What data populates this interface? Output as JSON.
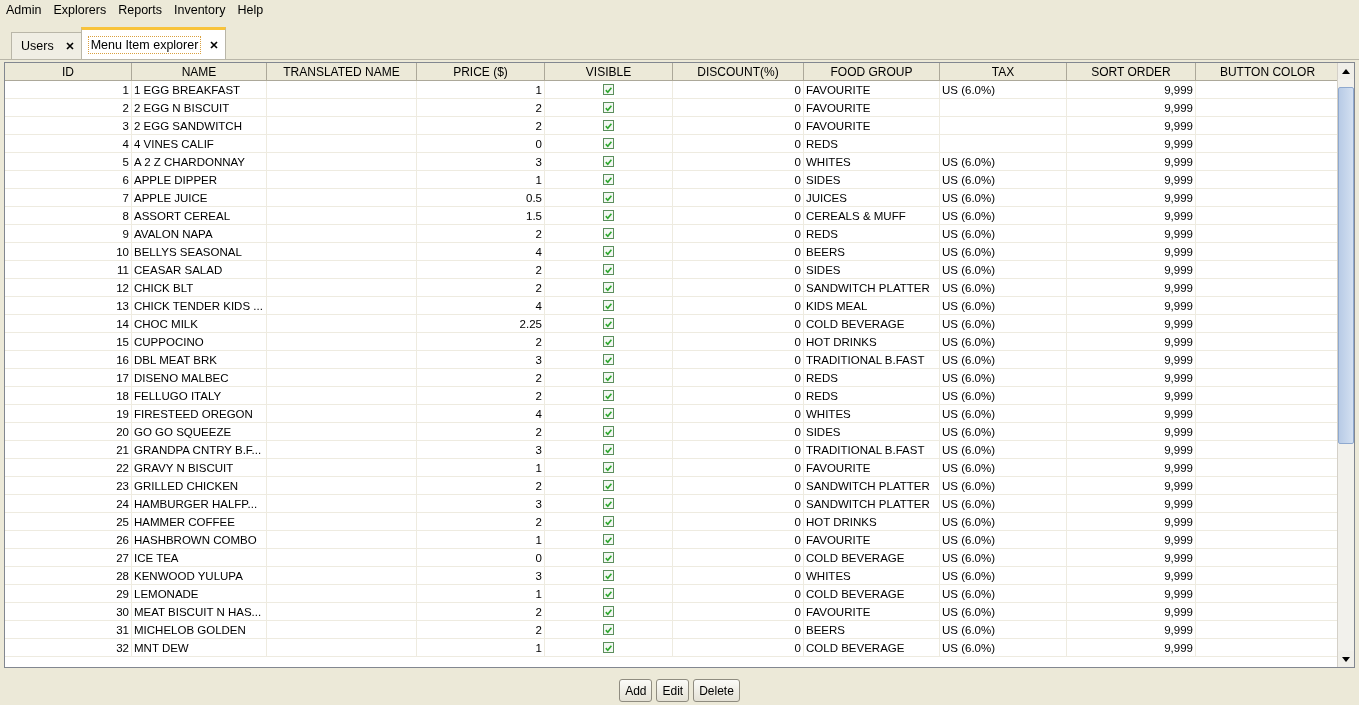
{
  "menu": [
    "Admin",
    "Explorers",
    "Reports",
    "Inventory",
    "Help"
  ],
  "tabs": [
    {
      "label": "Users",
      "selected": false
    },
    {
      "label": "Menu Item explorer",
      "selected": true
    }
  ],
  "table": {
    "columns": [
      "ID",
      "NAME",
      "TRANSLATED NAME",
      "PRICE ($)",
      "VISIBLE",
      "DISCOUNT(%)",
      "FOOD GROUP",
      "TAX",
      "SORT ORDER",
      "BUTTON COLOR"
    ],
    "rows": [
      {
        "id": "1",
        "name": "1 EGG BREAKFAST",
        "price": "1",
        "visible": true,
        "discount": "0",
        "food_group": "FAVOURITE",
        "tax": "US (6.0%)",
        "sort_order": "9,999"
      },
      {
        "id": "2",
        "name": "2 EGG N BISCUIT",
        "price": "2",
        "visible": true,
        "discount": "0",
        "food_group": "FAVOURITE",
        "sort_order": "9,999"
      },
      {
        "id": "3",
        "name": "2 EGG SANDWITCH",
        "price": "2",
        "visible": true,
        "discount": "0",
        "food_group": "FAVOURITE",
        "sort_order": "9,999"
      },
      {
        "id": "4",
        "name": "4 VINES CALIF",
        "price": "0",
        "visible": true,
        "discount": "0",
        "food_group": "REDS",
        "sort_order": "9,999"
      },
      {
        "id": "5",
        "name": "A 2 Z CHARDONNAY",
        "price": "3",
        "visible": true,
        "discount": "0",
        "food_group": "WHITES",
        "tax": "US (6.0%)",
        "sort_order": "9,999"
      },
      {
        "id": "6",
        "name": "APPLE DIPPER",
        "price": "1",
        "visible": true,
        "discount": "0",
        "food_group": "SIDES",
        "tax": "US (6.0%)",
        "sort_order": "9,999"
      },
      {
        "id": "7",
        "name": "APPLE JUICE",
        "price": "0.5",
        "visible": true,
        "discount": "0",
        "food_group": "JUICES",
        "tax": "US (6.0%)",
        "sort_order": "9,999"
      },
      {
        "id": "8",
        "name": "ASSORT CEREAL",
        "price": "1.5",
        "visible": true,
        "discount": "0",
        "food_group": "CEREALS & MUFF",
        "tax": "US (6.0%)",
        "sort_order": "9,999"
      },
      {
        "id": "9",
        "name": "AVALON NAPA",
        "price": "2",
        "visible": true,
        "discount": "0",
        "food_group": "REDS",
        "tax": "US (6.0%)",
        "sort_order": "9,999"
      },
      {
        "id": "10",
        "name": "BELLYS SEASONAL",
        "price": "4",
        "visible": true,
        "discount": "0",
        "food_group": "BEERS",
        "tax": "US (6.0%)",
        "sort_order": "9,999"
      },
      {
        "id": "11",
        "name": "CEASAR SALAD",
        "price": "2",
        "visible": true,
        "discount": "0",
        "food_group": "SIDES",
        "tax": "US (6.0%)",
        "sort_order": "9,999"
      },
      {
        "id": "12",
        "name": "CHICK BLT",
        "price": "2",
        "visible": true,
        "discount": "0",
        "food_group": "SANDWITCH PLATTER",
        "tax": "US (6.0%)",
        "sort_order": "9,999"
      },
      {
        "id": "13",
        "name": "CHICK TENDER KIDS ...",
        "price": "4",
        "visible": true,
        "discount": "0",
        "food_group": "KIDS MEAL",
        "tax": "US (6.0%)",
        "sort_order": "9,999"
      },
      {
        "id": "14",
        "name": "CHOC MILK",
        "price": "2.25",
        "visible": true,
        "discount": "0",
        "food_group": "COLD BEVERAGE",
        "tax": "US (6.0%)",
        "sort_order": "9,999"
      },
      {
        "id": "15",
        "name": "CUPPOCINO",
        "price": "2",
        "visible": true,
        "discount": "0",
        "food_group": "HOT DRINKS",
        "tax": "US (6.0%)",
        "sort_order": "9,999"
      },
      {
        "id": "16",
        "name": "DBL MEAT BRK",
        "price": "3",
        "visible": true,
        "discount": "0",
        "food_group": "TRADITIONAL B.FAST",
        "tax": "US (6.0%)",
        "sort_order": "9,999"
      },
      {
        "id": "17",
        "name": "DISENO MALBEC",
        "price": "2",
        "visible": true,
        "discount": "0",
        "food_group": "REDS",
        "tax": "US (6.0%)",
        "sort_order": "9,999"
      },
      {
        "id": "18",
        "name": "FELLUGO ITALY",
        "price": "2",
        "visible": true,
        "discount": "0",
        "food_group": "REDS",
        "tax": "US (6.0%)",
        "sort_order": "9,999"
      },
      {
        "id": "19",
        "name": "FIRESTEED OREGON",
        "price": "4",
        "visible": true,
        "discount": "0",
        "food_group": "WHITES",
        "tax": "US (6.0%)",
        "sort_order": "9,999"
      },
      {
        "id": "20",
        "name": "GO GO SQUEEZE",
        "price": "2",
        "visible": true,
        "discount": "0",
        "food_group": "SIDES",
        "tax": "US (6.0%)",
        "sort_order": "9,999"
      },
      {
        "id": "21",
        "name": "GRANDPA CNTRY B.F...",
        "price": "3",
        "visible": true,
        "discount": "0",
        "food_group": "TRADITIONAL B.FAST",
        "tax": "US (6.0%)",
        "sort_order": "9,999"
      },
      {
        "id": "22",
        "name": "GRAVY N BISCUIT",
        "price": "1",
        "visible": true,
        "discount": "0",
        "food_group": "FAVOURITE",
        "tax": "US (6.0%)",
        "sort_order": "9,999"
      },
      {
        "id": "23",
        "name": "GRILLED CHICKEN",
        "price": "2",
        "visible": true,
        "discount": "0",
        "food_group": "SANDWITCH PLATTER",
        "tax": "US (6.0%)",
        "sort_order": "9,999"
      },
      {
        "id": "24",
        "name": "HAMBURGER HALFP...",
        "price": "3",
        "visible": true,
        "discount": "0",
        "food_group": "SANDWITCH PLATTER",
        "tax": "US (6.0%)",
        "sort_order": "9,999"
      },
      {
        "id": "25",
        "name": "HAMMER COFFEE",
        "price": "2",
        "visible": true,
        "discount": "0",
        "food_group": "HOT DRINKS",
        "tax": "US (6.0%)",
        "sort_order": "9,999"
      },
      {
        "id": "26",
        "name": "HASHBROWN COMBO",
        "price": "1",
        "visible": true,
        "discount": "0",
        "food_group": "FAVOURITE",
        "tax": "US (6.0%)",
        "sort_order": "9,999"
      },
      {
        "id": "27",
        "name": "ICE TEA",
        "price": "0",
        "visible": true,
        "discount": "0",
        "food_group": "COLD BEVERAGE",
        "tax": "US (6.0%)",
        "sort_order": "9,999"
      },
      {
        "id": "28",
        "name": "KENWOOD YULUPA",
        "price": "3",
        "visible": true,
        "discount": "0",
        "food_group": "WHITES",
        "tax": "US (6.0%)",
        "sort_order": "9,999"
      },
      {
        "id": "29",
        "name": "LEMONADE",
        "price": "1",
        "visible": true,
        "discount": "0",
        "food_group": "COLD BEVERAGE",
        "tax": "US (6.0%)",
        "sort_order": "9,999"
      },
      {
        "id": "30",
        "name": "MEAT BISCUIT N HAS...",
        "price": "2",
        "visible": true,
        "discount": "0",
        "food_group": "FAVOURITE",
        "tax": "US (6.0%)",
        "sort_order": "9,999"
      },
      {
        "id": "31",
        "name": "MICHELOB GOLDEN",
        "price": "2",
        "visible": true,
        "discount": "0",
        "food_group": "BEERS",
        "tax": "US (6.0%)",
        "sort_order": "9,999"
      },
      {
        "id": "32",
        "name": "MNT DEW",
        "price": "1",
        "visible": true,
        "discount": "0",
        "food_group": "COLD BEVERAGE",
        "tax": "US (6.0%)",
        "sort_order": "9,999"
      }
    ]
  },
  "buttons": [
    "Add",
    "Edit",
    "Delete"
  ]
}
